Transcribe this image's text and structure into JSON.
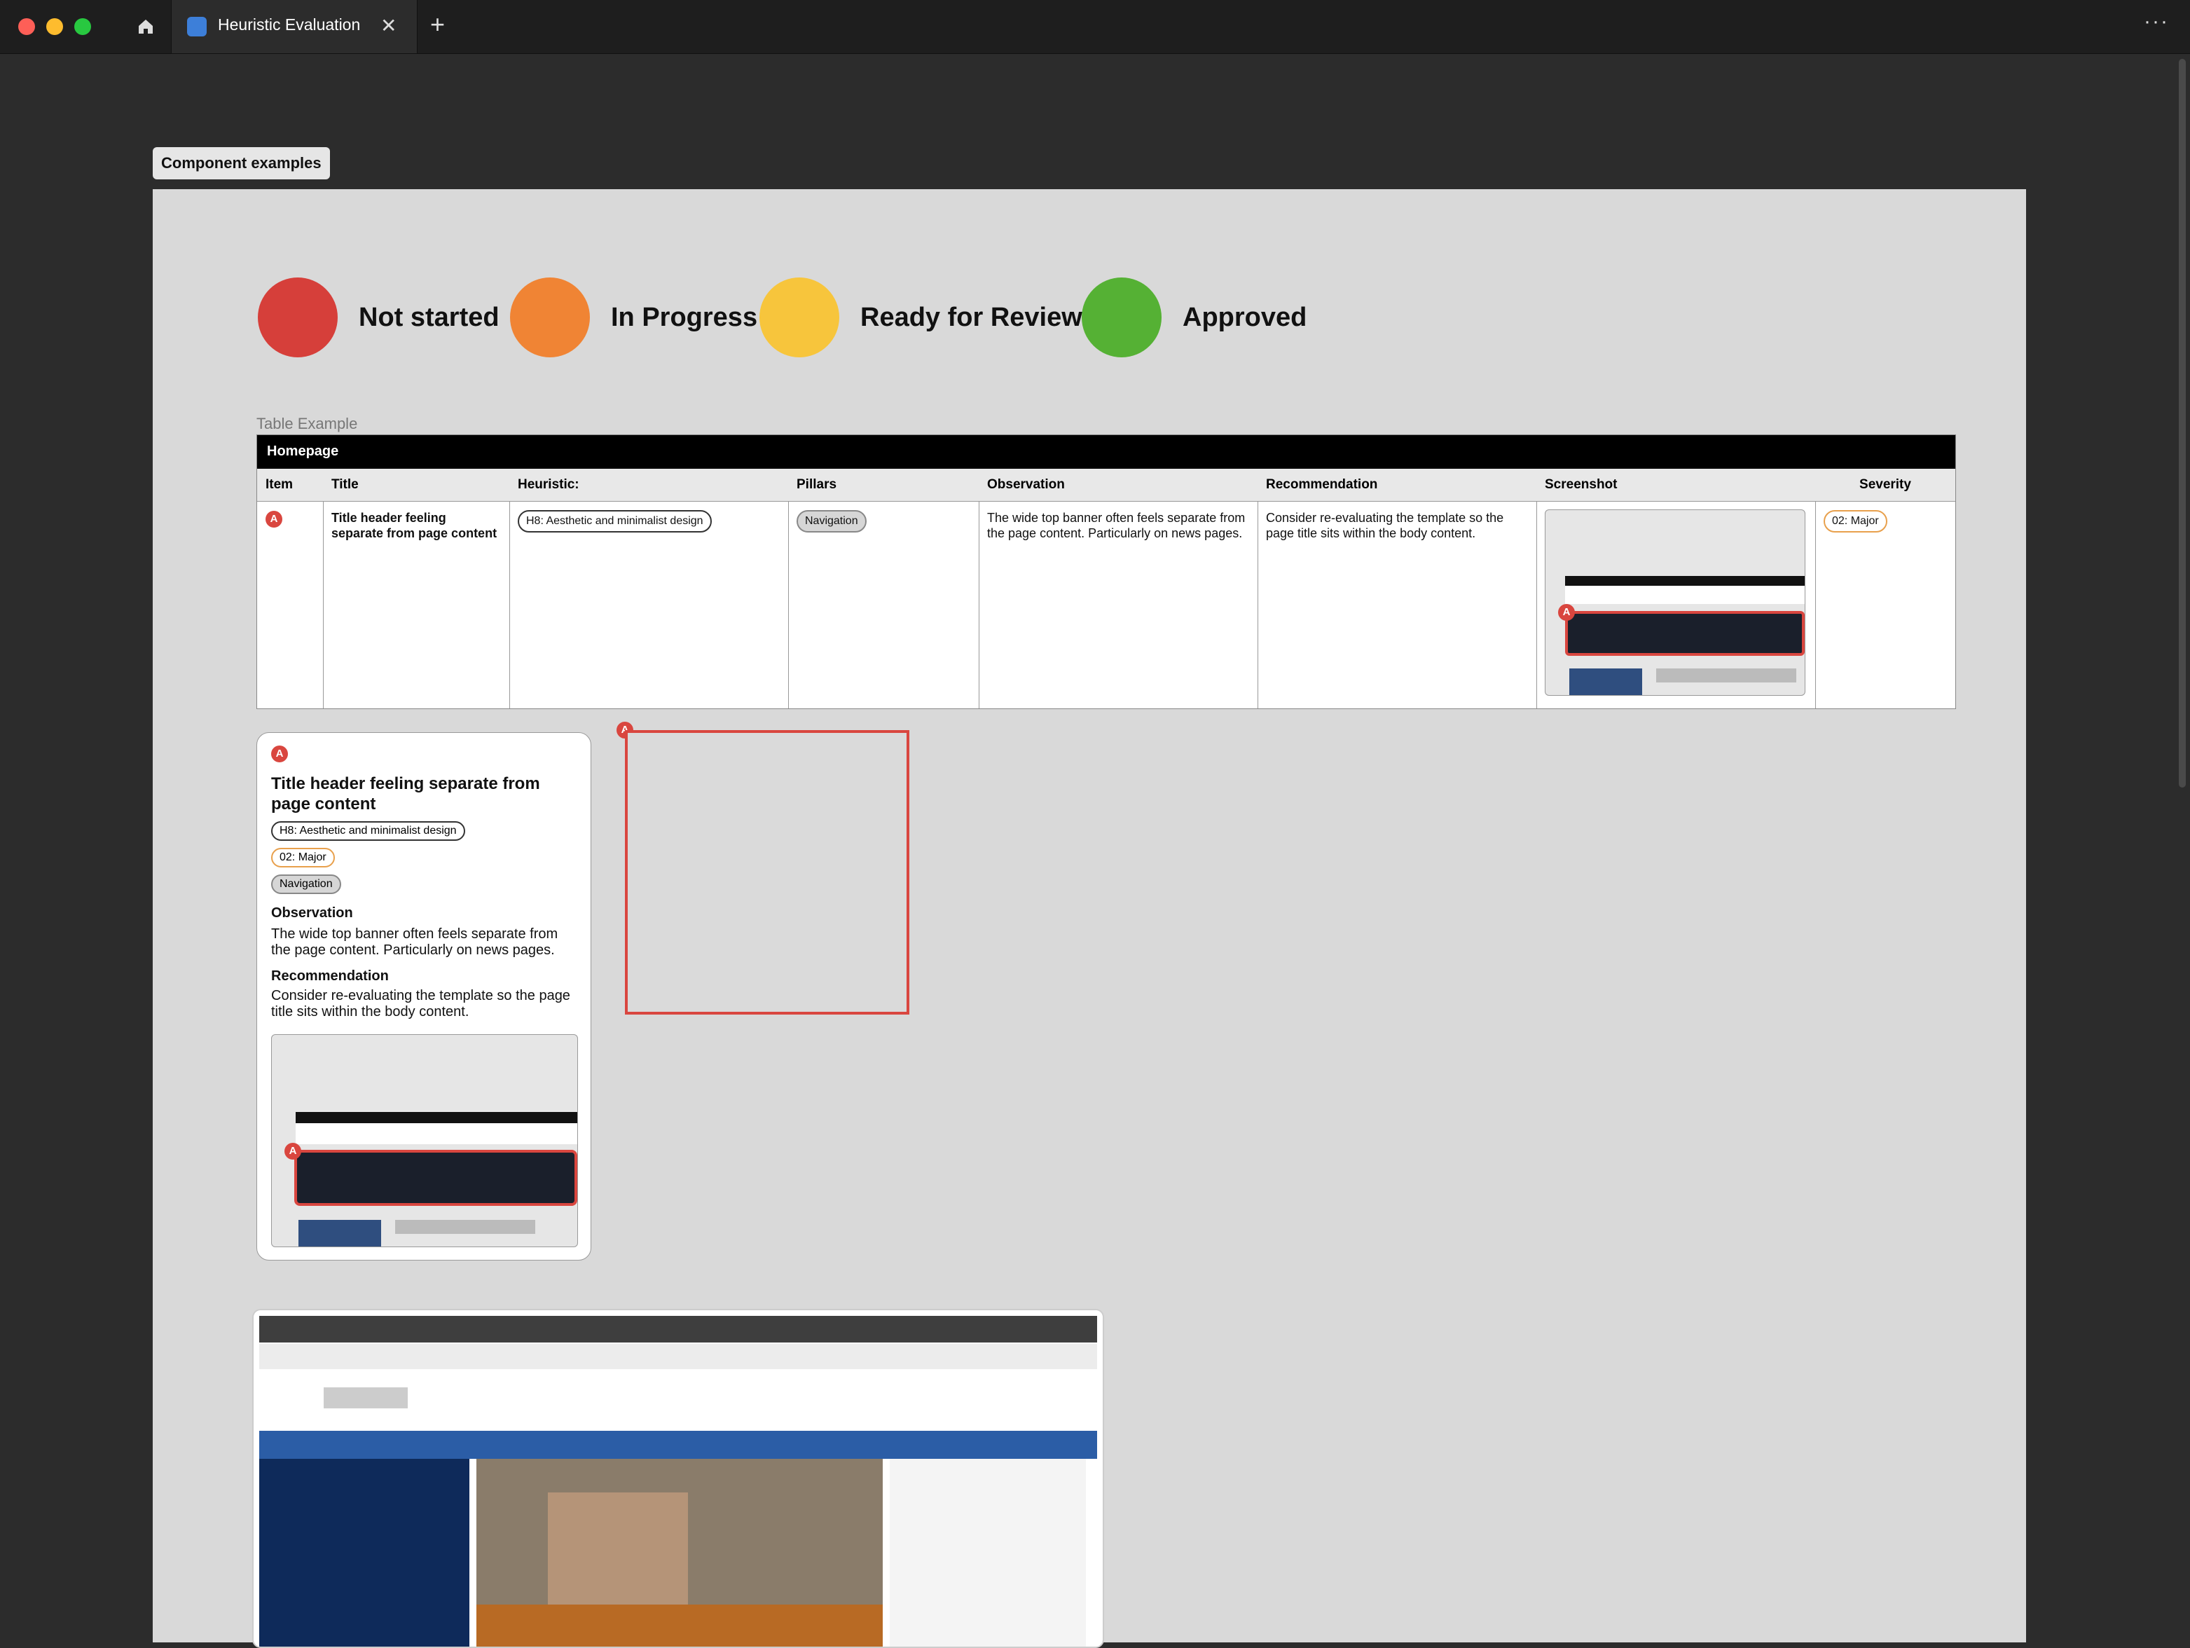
{
  "window": {
    "tab_title": "Heuristic Evaluation",
    "tab_icon": "figjam-file-icon",
    "home_icon": "home-icon",
    "close_glyph": "✕",
    "newtab_glyph": "+",
    "menu_glyph": "···"
  },
  "frame": {
    "label": "Component examples"
  },
  "statuses": [
    {
      "label": "Not started",
      "color": "#d63f3a"
    },
    {
      "label": "In Progress",
      "color": "#f08434"
    },
    {
      "label": "Ready for Review",
      "color": "#f7c53c"
    },
    {
      "label": "Approved",
      "color": "#55b134"
    }
  ],
  "table": {
    "caption": "Table Example",
    "header": "Homepage",
    "columns": [
      "Item",
      "Title",
      "Heuristic:",
      "Pillars",
      "Observation",
      "Recommendation",
      "Screenshot",
      "Severity"
    ],
    "row": {
      "item": "A",
      "title": "Title header feeling separate from page content",
      "heuristic": "H8: Aesthetic and minimalist design",
      "pillar": "Navigation",
      "observation": "The wide top banner often feels separate from the page content. Particularly on news pages.",
      "recommendation": "Consider re-evaluating the template so the page title sits within the body content.",
      "severity": "02: Major"
    }
  },
  "card": {
    "item": "A",
    "title": "Title header feeling separate from page content",
    "heuristic": "H8: Aesthetic and minimalist design",
    "severity": "02: Major",
    "pillar": "Navigation",
    "observation_heading": "Observation",
    "observation": "The wide top banner often feels separate from the page content. Particularly on news pages.",
    "recommendation_heading": "Recommendation",
    "recommendation": "Consider re-evaluating the template so the page title sits within the body content."
  },
  "annotation": {
    "item": "A"
  }
}
